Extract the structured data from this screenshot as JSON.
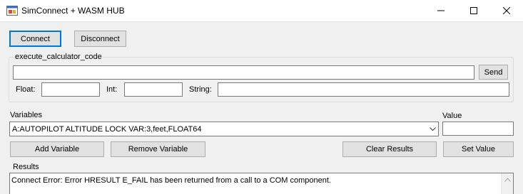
{
  "window": {
    "title": "SimConnect + WASM HUB",
    "minimize_icon": "minimize-icon",
    "maximize_icon": "maximize-icon",
    "close_icon": "close-icon"
  },
  "toolbar": {
    "connect_label": "Connect",
    "disconnect_label": "Disconnect"
  },
  "calculator": {
    "group_label": "execute_calculator_code",
    "code_value": "",
    "send_label": "Send",
    "float_label": "Float:",
    "float_value": "",
    "int_label": "Int:",
    "int_value": "",
    "string_label": "String:",
    "string_value": ""
  },
  "variables": {
    "label": "Variables",
    "selected": "A:AUTOPILOT ALTITUDE LOCK VAR:3,feet,FLOAT64",
    "value_label": "Value",
    "value": "",
    "add_label": "Add Variable",
    "remove_label": "Remove Variable",
    "clear_label": "Clear Results",
    "set_label": "Set Value"
  },
  "results": {
    "label": "Results",
    "lines": [
      "Connect Error: Error HRESULT E_FAIL has been returned from a call to a COM component."
    ]
  },
  "colors": {
    "accent": "#0078d7",
    "window_bg": "#f0f0f0",
    "button_bg": "#e1e1e1"
  }
}
